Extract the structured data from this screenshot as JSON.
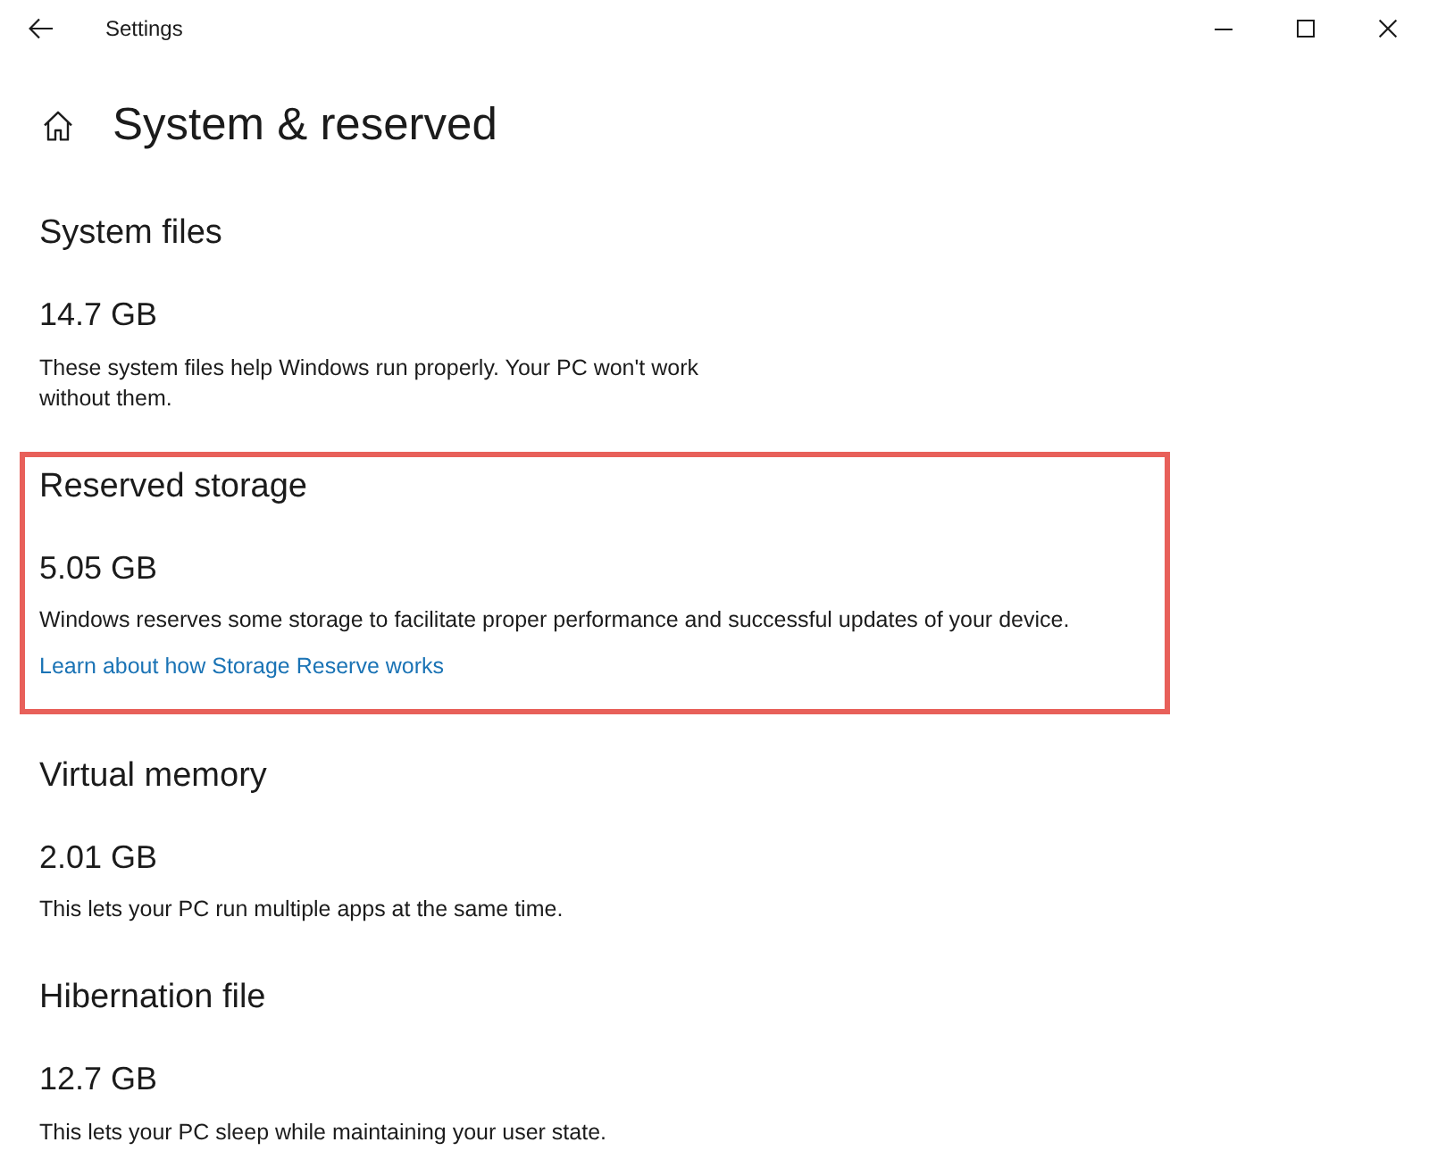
{
  "window": {
    "title": "Settings"
  },
  "page": {
    "title": "System & reserved"
  },
  "sections": [
    {
      "heading": "System files",
      "size": "14.7 GB",
      "description": "These system files help Windows run properly. Your PC won't work without them.",
      "highlighted": false
    },
    {
      "heading": "Reserved storage",
      "size": "5.05 GB",
      "description": "Windows reserves some storage to facilitate proper performance and successful updates of your device.",
      "link": "Learn about how Storage Reserve works",
      "highlighted": true
    },
    {
      "heading": "Virtual memory",
      "size": "2.01 GB",
      "description": "This lets your PC run multiple apps at the same time.",
      "highlighted": false
    },
    {
      "heading": "Hibernation file",
      "size": "12.7 GB",
      "description": "This lets your PC sleep while maintaining your user state.",
      "highlighted": false
    }
  ]
}
